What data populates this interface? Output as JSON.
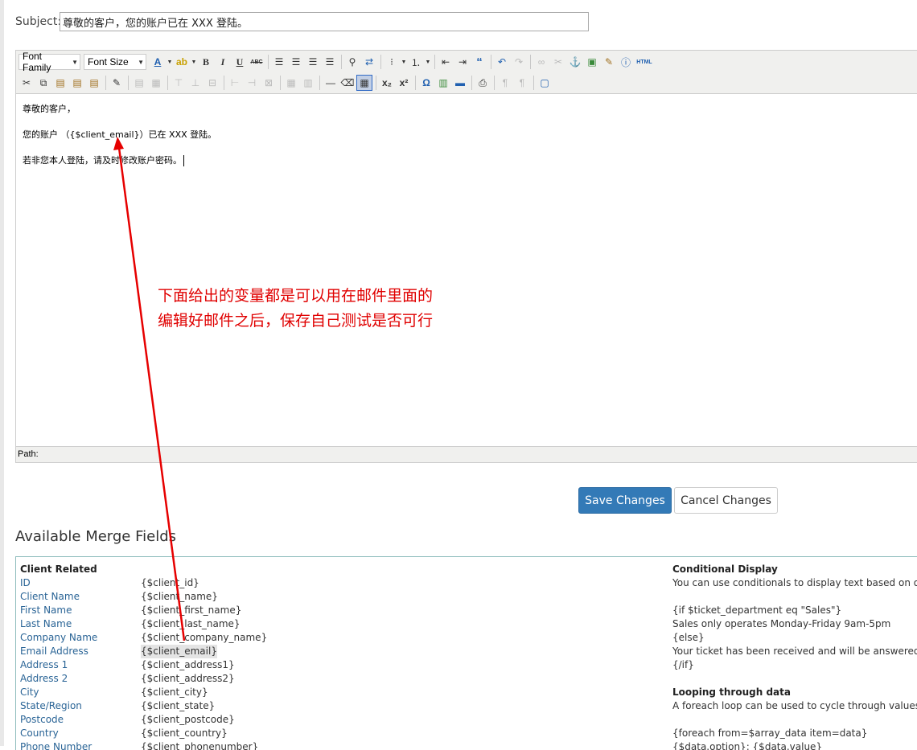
{
  "subject": {
    "label": "Subject:",
    "value": "尊敬的客户，您的账户已在 XXX 登陆。"
  },
  "toolbar": {
    "font_family": "Font Family",
    "font_size": "Font Size"
  },
  "editor": {
    "line1": "尊敬的客户，",
    "line2": "您的账户 （{$client_email}）已在 XXX 登陆。",
    "line3": "若非您本人登陆，请及时修改账户密码。",
    "path_label": "Path:"
  },
  "annotation": {
    "line1": "下面给出的变量都是可以用在邮件里面的",
    "line2": "编辑好邮件之后，保存自己测试是否可行",
    "color": "#e00000"
  },
  "buttons": {
    "save": "Save Changes",
    "cancel": "Cancel Changes"
  },
  "merge_fields": {
    "heading": "Available Merge Fields",
    "client_heading": "Client Related",
    "client": [
      {
        "label": "ID",
        "var": "{$client_id}"
      },
      {
        "label": "Client Name",
        "var": "{$client_name}"
      },
      {
        "label": "First Name",
        "var": "{$client_first_name}"
      },
      {
        "label": "Last Name",
        "var": "{$client_last_name}"
      },
      {
        "label": "Company Name",
        "var": "{$client_company_name}"
      },
      {
        "label": "Email Address",
        "var": "{$client_email}"
      },
      {
        "label": "Address 1",
        "var": "{$client_address1}"
      },
      {
        "label": "Address 2",
        "var": "{$client_address2}"
      },
      {
        "label": "City",
        "var": "{$client_city}"
      },
      {
        "label": "State/Region",
        "var": "{$client_state}"
      },
      {
        "label": "Postcode",
        "var": "{$client_postcode}"
      },
      {
        "label": "Country",
        "var": "{$client_country}"
      },
      {
        "label": "Phone Number",
        "var": "{$client_phonenumber}"
      }
    ],
    "conditional": {
      "heading": "Conditional Display",
      "desc": "You can use conditionals to display text based on othe",
      "code1": "{if $ticket_department eq \"Sales\"}",
      "code2": "Sales only operates Monday-Friday 9am-5pm",
      "code3": "{else}",
      "code4": "Your ticket has been received and will be answered sho",
      "code5": "{/if}"
    },
    "looping": {
      "heading": "Looping through data",
      "desc": "A foreach loop can be used to cycle through values like",
      "code1": "{foreach from=$array_data item=data}",
      "code2": "{$data.option}: {$data.value}"
    }
  }
}
